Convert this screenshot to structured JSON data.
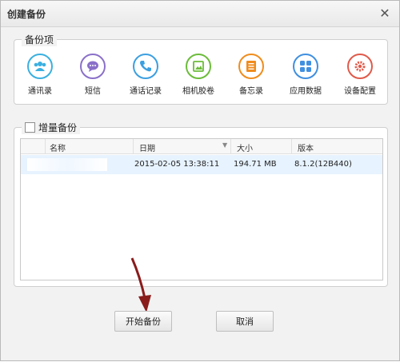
{
  "dialog": {
    "title": "创建备份",
    "close_glyph": "✕"
  },
  "backup_items": {
    "label": "备份项",
    "items": [
      {
        "label": "通讯录",
        "icon": "contacts-icon",
        "color": "#3ab0e0"
      },
      {
        "label": "短信",
        "icon": "sms-icon",
        "color": "#8a70c9"
      },
      {
        "label": "通话记录",
        "icon": "call-log-icon",
        "color": "#3c9fe0"
      },
      {
        "label": "相机胶卷",
        "icon": "camera-roll-icon",
        "color": "#6cbc3a"
      },
      {
        "label": "备忘录",
        "icon": "notes-icon",
        "color": "#f08c1c"
      },
      {
        "label": "应用数据",
        "icon": "app-data-icon",
        "color": "#3f8fe0"
      },
      {
        "label": "设备配置",
        "icon": "device-settings-icon",
        "color": "#e05a4a"
      }
    ]
  },
  "incremental": {
    "label": "增量备份",
    "checked": false,
    "columns": [
      "名称",
      "日期",
      "大小",
      "版本"
    ],
    "rows": [
      {
        "name": "",
        "date": "2015-02-05 13:38:11",
        "size": "194.71 MB",
        "version": "8.1.2(12B440)"
      }
    ]
  },
  "buttons": {
    "start": "开始备份",
    "cancel": "取消"
  }
}
